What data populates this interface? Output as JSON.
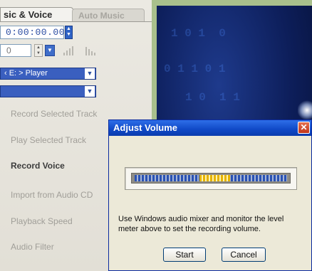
{
  "tabs": {
    "active": "sic & Voice",
    "inactive": "Auto Music"
  },
  "timer": {
    "value": "0:00:00.00"
  },
  "number_field": {
    "value": "0"
  },
  "device_select": {
    "value": "‹ E: > Player"
  },
  "second_select": {
    "value": ""
  },
  "menu": {
    "record_selected_track": "Record Selected Track",
    "play_selected_track": "Play Selected Track",
    "record_voice": "Record Voice",
    "import_audio_cd": "Import from Audio CD",
    "playback_speed": "Playback Speed",
    "audio_filter": "Audio Filter"
  },
  "dialog": {
    "title": "Adjust Volume",
    "close": "✕",
    "description": "Use Windows audio mixer and monitor the level meter above to set the recording volume.",
    "start_label": "Start",
    "cancel_label": "Cancel",
    "meter_level": {
      "start": 0.42,
      "end": 0.62
    }
  },
  "colors": {
    "accent": "#2e62c6",
    "titlebar": "#0f48c6",
    "meter_active": "#e5b200"
  }
}
